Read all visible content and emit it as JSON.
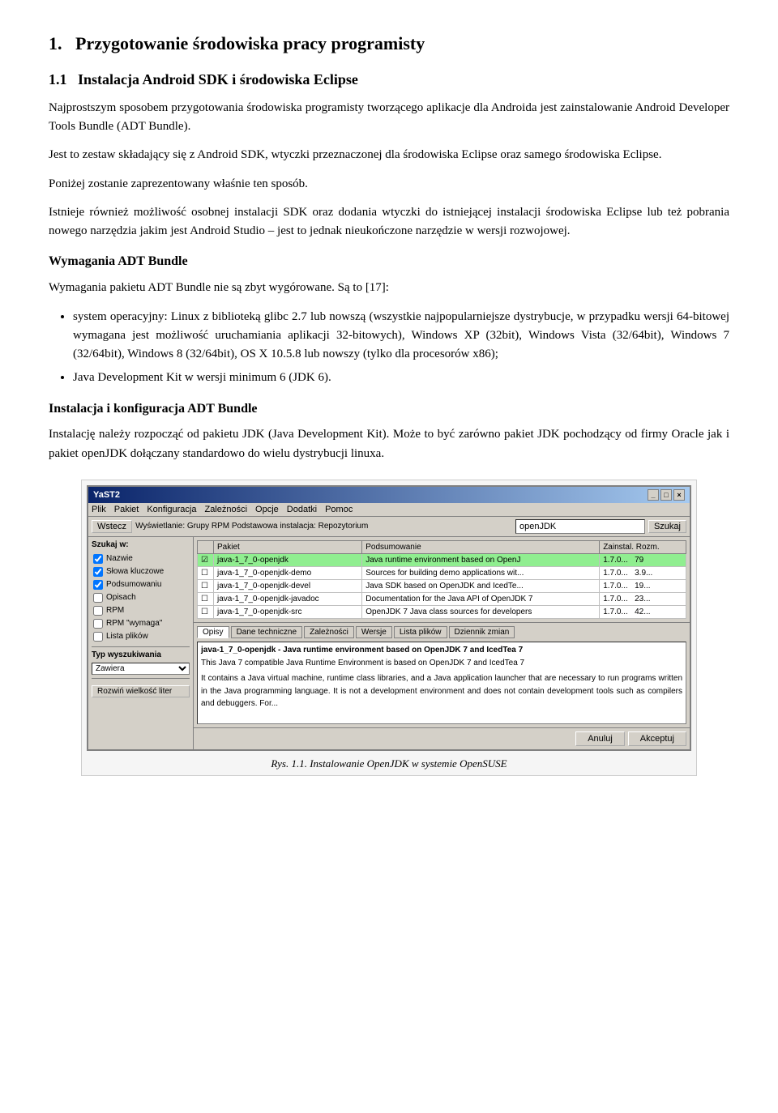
{
  "chapter": {
    "number": "1.",
    "title": "Przygotowanie środowiska pracy programisty"
  },
  "section1": {
    "number": "1.1",
    "title": "Instalacja Android SDK i środowiska Eclipse",
    "intro": "Najprostszym sposobem przygotowania środowiska programisty tworzącego aplikacje dla Androida jest zainstalowanie Android Developer Tools Bundle (ADT Bundle).",
    "p2": "Jest to zestaw składający się z Android SDK, wtyczki przeznaczonej dla środowiska Eclipse oraz samego środowiska Eclipse.",
    "p3": "Poniżej zostanie zaprezentowany właśnie ten sposób.",
    "p4": "Istnieje również możliwość osobnej instalacji SDK oraz dodania wtyczki do istniejącej instalacji środowiska Eclipse lub też pobrania nowego narzędzia jakim jest Android Studio – jest to jednak nieukończone narzędzie w wersji rozwojowej."
  },
  "subsection_adt": {
    "title": "Wymagania ADT Bundle",
    "p1": "Wymagania pakietu ADT Bundle nie są zbyt wygórowane. Są to [17]:",
    "list": [
      "system operacyjny: Linux z biblioteką glibc 2.7 lub nowszą (wszystkie najpopularniejsze dystrybucje, w przypadku wersji 64-bitowej wymagana jest możliwość uruchamiania aplikacji 32-bitowych), Windows XP (32bit), Windows Vista (32/64bit), Windows 7  (32/64bit), Windows 8 (32/64bit), OS X 10.5.8 lub nowszy (tylko dla procesorów x86);",
      "Java Development Kit w wersji minimum 6 (JDK 6)."
    ]
  },
  "subsection_install": {
    "title": "Instalacja i konfiguracja ADT Bundle",
    "p1": "Instalację należy rozpocząć od pakietu JDK (Java Development Kit). Może to być zarówno pakiet JDK pochodzący od firmy Oracle jak i pakiet openJDK dołączany standardowo do wielu dystrybucji linuxa."
  },
  "figure": {
    "titlebar": "YaST2",
    "titlebar_buttons": [
      "_",
      "□",
      "×"
    ],
    "menu": [
      "Plik",
      "Pakiet",
      "Konfiguracja",
      "Zależności",
      "Opcje",
      "Dodatki",
      "Pomoc"
    ],
    "toolbar": {
      "back_label": "Wstecz",
      "view_label": "Wyświetlanie: Grupy RPM Podstawowa instalacja: Repozytorium",
      "search_placeholder": "openJDK",
      "search_btn": "Szukaj"
    },
    "sidebar": {
      "label": "Szukaj w:",
      "items": [
        {
          "checked": true,
          "label": "Nazwie"
        },
        {
          "checked": true,
          "label": "Słowa kluczowe"
        },
        {
          "checked": true,
          "label": "Podsumowaniu"
        },
        {
          "checked": false,
          "label": "Opisach"
        },
        {
          "checked": false,
          "label": "RPM"
        },
        {
          "checked": false,
          "label": "RPM \"wymaga\""
        },
        {
          "checked": false,
          "label": "Lista plików"
        }
      ],
      "type_label": "Typ wyszukiwania",
      "type_options": [
        "Zawiera"
      ],
      "search_btn2": "Zawiera",
      "restart_btn": "Rozwiń wielkość liter"
    },
    "table": {
      "headers": [
        "",
        "Pakiet",
        "Podsumowanie",
        "Zainstal. Rozm."
      ],
      "rows": [
        {
          "selected": true,
          "pkg": "java-1_7_0-openjdk",
          "summary": "Java runtime environment based on OpenJ",
          "ver": "1.7.0...",
          "size": "79"
        },
        {
          "selected": false,
          "pkg": "java-1_7_0-openjdk-demo",
          "summary": "Sources for building demo applications wit...",
          "ver": "1.7.0...",
          "size": "3.9..."
        },
        {
          "selected": false,
          "pkg": "java-1_7_0-openjdk-devel",
          "summary": "Java SDK based on OpenJDK and IcedTe...",
          "ver": "1.7.0...",
          "size": "19..."
        },
        {
          "selected": false,
          "pkg": "java-1_7_0-openjdk-javadoc",
          "summary": "Documentation for the Java API of OpenJDK 7",
          "ver": "1.7.0...",
          "size": "23..."
        },
        {
          "selected": false,
          "pkg": "java-1_7_0-openjdk-src",
          "summary": "OpenJDK 7 Java class sources for developers",
          "ver": "1.7.0...",
          "size": "42..."
        }
      ]
    },
    "detail": {
      "tabs": [
        "Opisy",
        "Dane techniczne",
        "Zależności",
        "Wersje",
        "Lista plików",
        "Dziennik zmian"
      ],
      "active_tab": "Opisy",
      "title": "java-1_7_0-openjdk - Java runtime environment based on OpenJDK 7 and IcedTea 7",
      "text1": "This Java 7 compatible Java Runtime Environment is based on OpenJDK 7 and IcedTea 7",
      "text2": "It contains a Java virtual machine, runtime class libraries, and a Java application launcher that are necessary to run programs written in the Java programming language. It is not a development environment and does not contain development tools such as compilers and debuggers. For..."
    },
    "bottom_buttons": [
      "Anuluj",
      "Akceptuj"
    ],
    "caption": "Rys. 1.1. Instalowanie OpenJDK w systemie OpenSUSE"
  }
}
